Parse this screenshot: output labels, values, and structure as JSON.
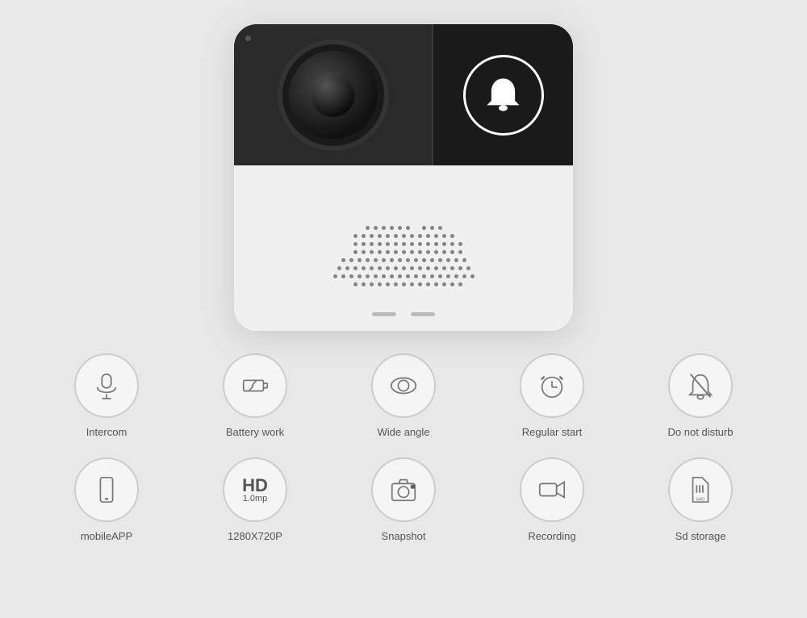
{
  "product": {
    "alt": "Smart Doorbell Camera"
  },
  "features_row1": [
    {
      "id": "intercom",
      "label": "Intercom",
      "icon": "microphone"
    },
    {
      "id": "battery-work",
      "label": "Battery work",
      "icon": "battery"
    },
    {
      "id": "wide-angle",
      "label": "Wide angle",
      "icon": "wide-angle"
    },
    {
      "id": "regular-start",
      "label": "Regular start",
      "icon": "clock-alarm"
    },
    {
      "id": "do-not-disturb",
      "label": "Do not disturb",
      "icon": "bell-slash"
    }
  ],
  "features_row2": [
    {
      "id": "mobile-app",
      "label": "mobileAPP",
      "icon": "mobile"
    },
    {
      "id": "resolution",
      "label": "1280X720P",
      "icon": "hd"
    },
    {
      "id": "snapshot",
      "label": "Snapshot",
      "icon": "camera"
    },
    {
      "id": "recording",
      "label": "Recording",
      "icon": "video"
    },
    {
      "id": "sd-storage",
      "label": "Sd storage",
      "icon": "sd-card"
    }
  ]
}
